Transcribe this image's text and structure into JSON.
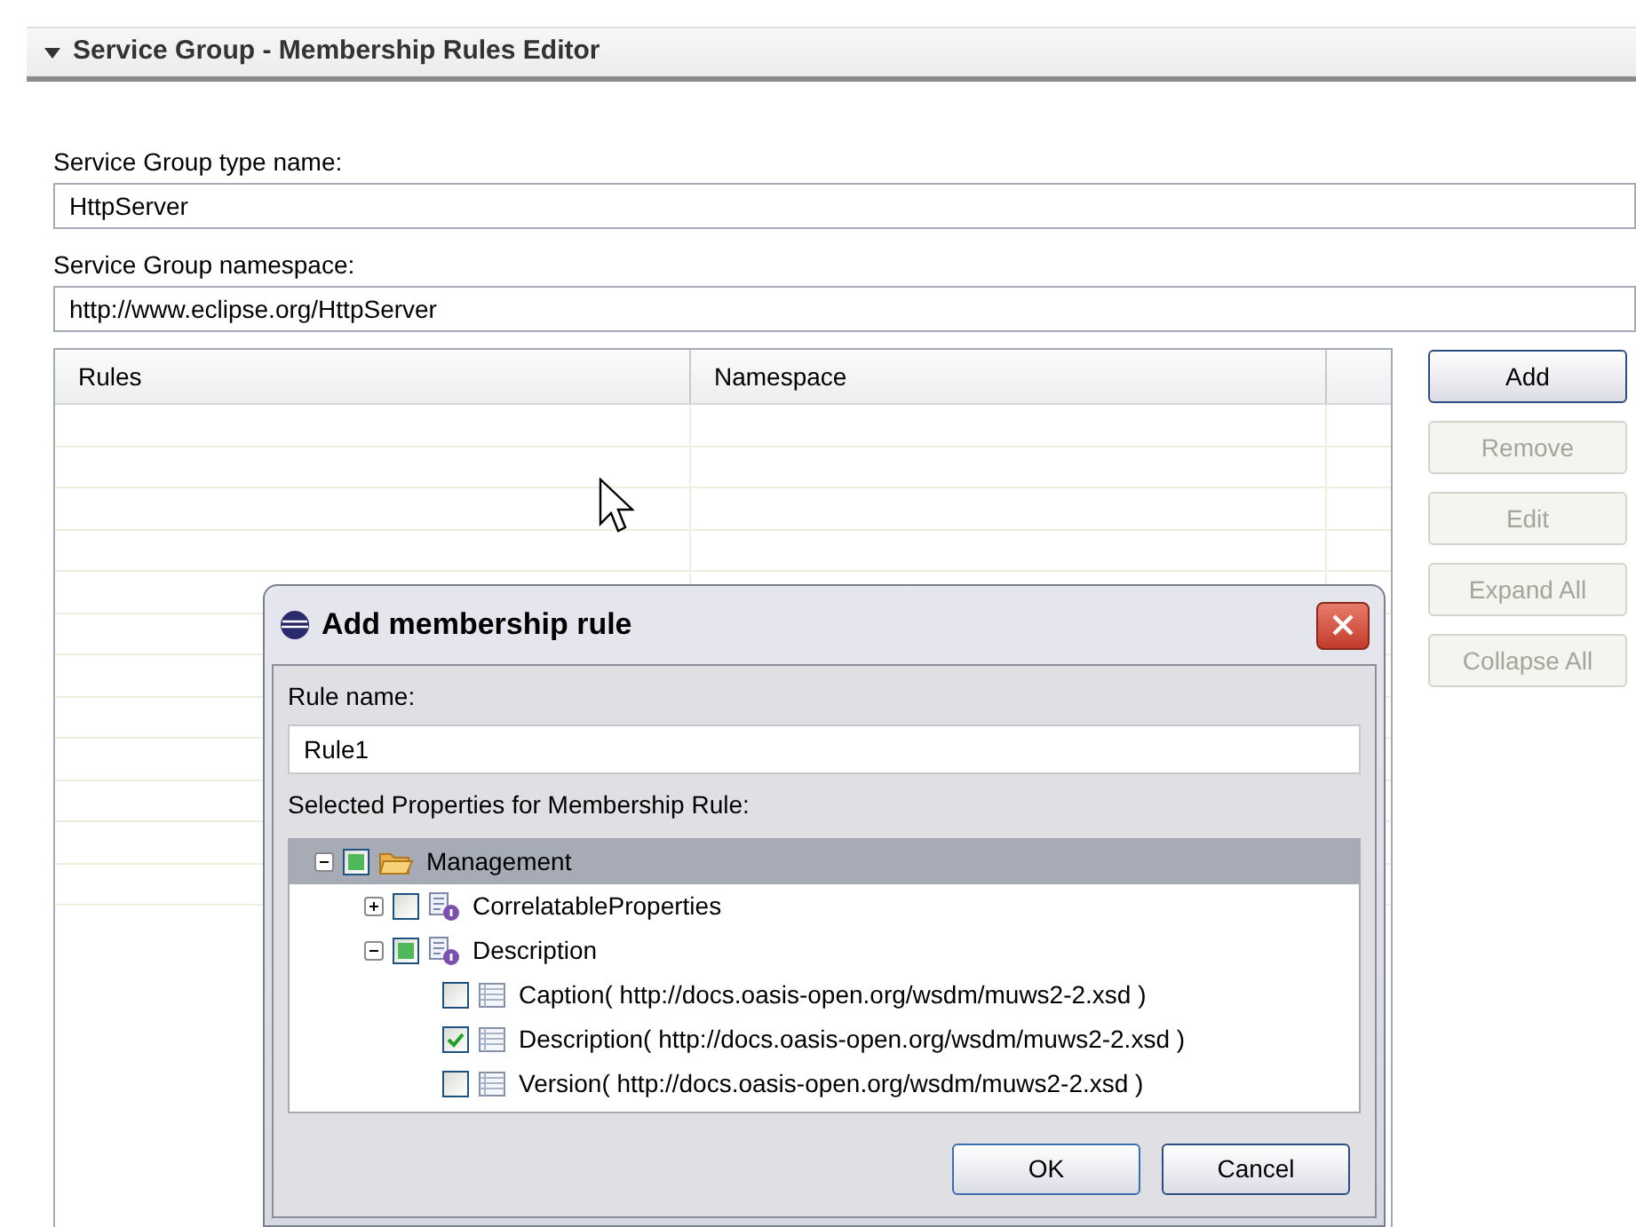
{
  "section": {
    "title": "Service Group - Membership Rules Editor",
    "expanded": true
  },
  "type_name": {
    "label": "Service Group type name:",
    "value": "HttpServer"
  },
  "namespace": {
    "label": "Service Group namespace:",
    "value": "http://www.eclipse.org/HttpServer"
  },
  "table": {
    "columns": [
      "Rules",
      "Namespace"
    ]
  },
  "buttons": [
    {
      "label": "Add",
      "disabled": false
    },
    {
      "label": "Remove",
      "disabled": true
    },
    {
      "label": "Edit",
      "disabled": true
    },
    {
      "label": "Expand All",
      "disabled": true
    },
    {
      "label": "Collapse All",
      "disabled": true
    }
  ],
  "dialog": {
    "title": "Add membership rule",
    "rule_label": "Rule name:",
    "rule_value": "Rule1",
    "tree_label": "Selected Properties for Membership Rule:",
    "tree": [
      {
        "label": "Management",
        "kind": "folder",
        "checked": false,
        "partial": true,
        "expanded": true,
        "selected": true,
        "children": [
          {
            "label": "CorrelatableProperties",
            "kind": "group",
            "checked": false,
            "partial": false,
            "expanded": false,
            "selected": false
          },
          {
            "label": "Description",
            "kind": "group",
            "checked": false,
            "partial": true,
            "expanded": true,
            "selected": false,
            "children": [
              {
                "label": "Caption( http://docs.oasis-open.org/wsdm/muws2-2.xsd )",
                "kind": "property",
                "checked": false,
                "selected": false
              },
              {
                "label": "Description( http://docs.oasis-open.org/wsdm/muws2-2.xsd )",
                "kind": "property",
                "checked": true,
                "selected": false
              },
              {
                "label": "Version( http://docs.oasis-open.org/wsdm/muws2-2.xsd )",
                "kind": "property",
                "checked": false,
                "selected": false
              }
            ]
          }
        ]
      }
    ],
    "buttons": [
      "OK",
      "Cancel"
    ]
  }
}
